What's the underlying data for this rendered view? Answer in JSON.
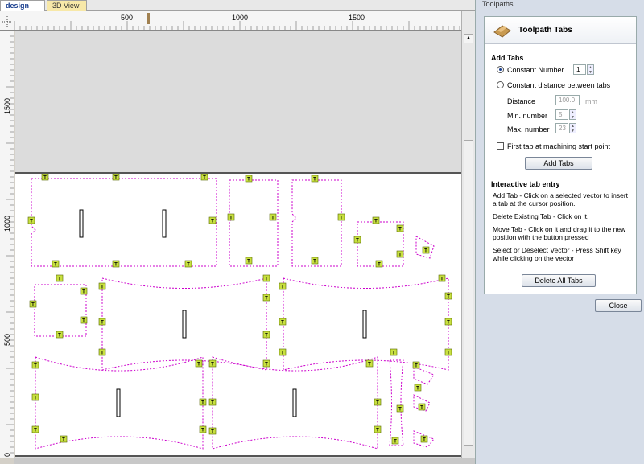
{
  "view_tabs": {
    "design": "design",
    "view3d": "3D View"
  },
  "ruler": {
    "h_labels": [
      "500",
      "1000",
      "1500"
    ],
    "v_labels": [
      "1500",
      "1000",
      "500",
      "0"
    ]
  },
  "panel": {
    "header": "Toolpaths",
    "title": "Toolpath Tabs",
    "add_tabs": {
      "heading": "Add Tabs",
      "constant_number_label": "Constant Number",
      "constant_number_value": "1",
      "constant_distance_label": "Constant distance between tabs",
      "distance_label": "Distance",
      "distance_value": "100.0",
      "distance_unit": "mm",
      "min_label": "Min. number",
      "min_value": "5",
      "max_label": "Max. number",
      "max_value": "23",
      "first_tab_label": "First tab at machining start point",
      "add_button": "Add Tabs"
    },
    "interactive": {
      "heading": "Interactive tab entry",
      "add_help": "Add Tab - Click on a selected vector to insert a tab at the cursor position.",
      "delete_help": "Delete Existing Tab - Click on it.",
      "move_help": "Move Tab - Click on it and drag it to the new position with the button pressed",
      "select_help": "Select or Deselect Vector - Press Shift key while clicking on the vector",
      "delete_all_button": "Delete All Tabs"
    },
    "close_button": "Close"
  },
  "colors": {
    "vector": "#cc00cc",
    "tab_fill": "#c8e040",
    "accent": "#1a3f8f"
  },
  "tab_glyph": "T"
}
